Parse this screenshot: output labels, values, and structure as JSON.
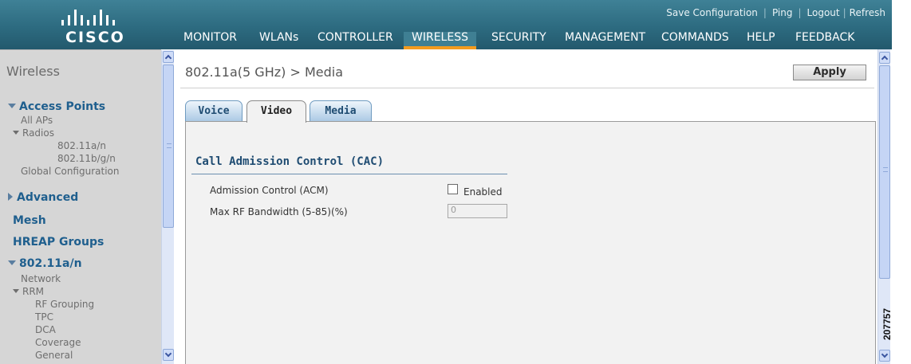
{
  "header": {
    "logo_text": "CISCO",
    "utility_links": [
      "Save Configuration",
      "Ping",
      "Logout",
      "Refresh"
    ],
    "nav": [
      "MONITOR",
      "WLANs",
      "CONTROLLER",
      "WIRELESS",
      "SECURITY",
      "MANAGEMENT",
      "COMMANDS",
      "HELP",
      "FEEDBACK"
    ],
    "active_nav": "WIRELESS",
    "colors": {
      "header": "#2d6b80",
      "active_underline": "#f39b1e"
    }
  },
  "sidebar": {
    "title": "Wireless",
    "items": [
      "Access Points",
      "All APs",
      "Radios",
      "802.11a/n",
      "802.11b/g/n",
      "Global Configuration",
      "Advanced",
      "Mesh",
      "HREAP Groups",
      "802.11a/n",
      "Network",
      "RRM",
      "RF Grouping",
      "TPC",
      "DCA",
      "Coverage",
      "General"
    ]
  },
  "main": {
    "title": "802.11a(5 GHz) > Media",
    "apply_label": "Apply",
    "tabs": [
      "Voice",
      "Video",
      "Media"
    ],
    "active_tab": "Video",
    "section_title": "Call Admission Control (CAC)",
    "fields": {
      "acm_label": "Admission Control (ACM)",
      "acm_checkbox_label": "Enabled",
      "acm_checked": false,
      "bandwidth_label": "Max RF Bandwidth (5-85)(%)",
      "bandwidth_value": "0"
    }
  },
  "figure_id": "207757"
}
